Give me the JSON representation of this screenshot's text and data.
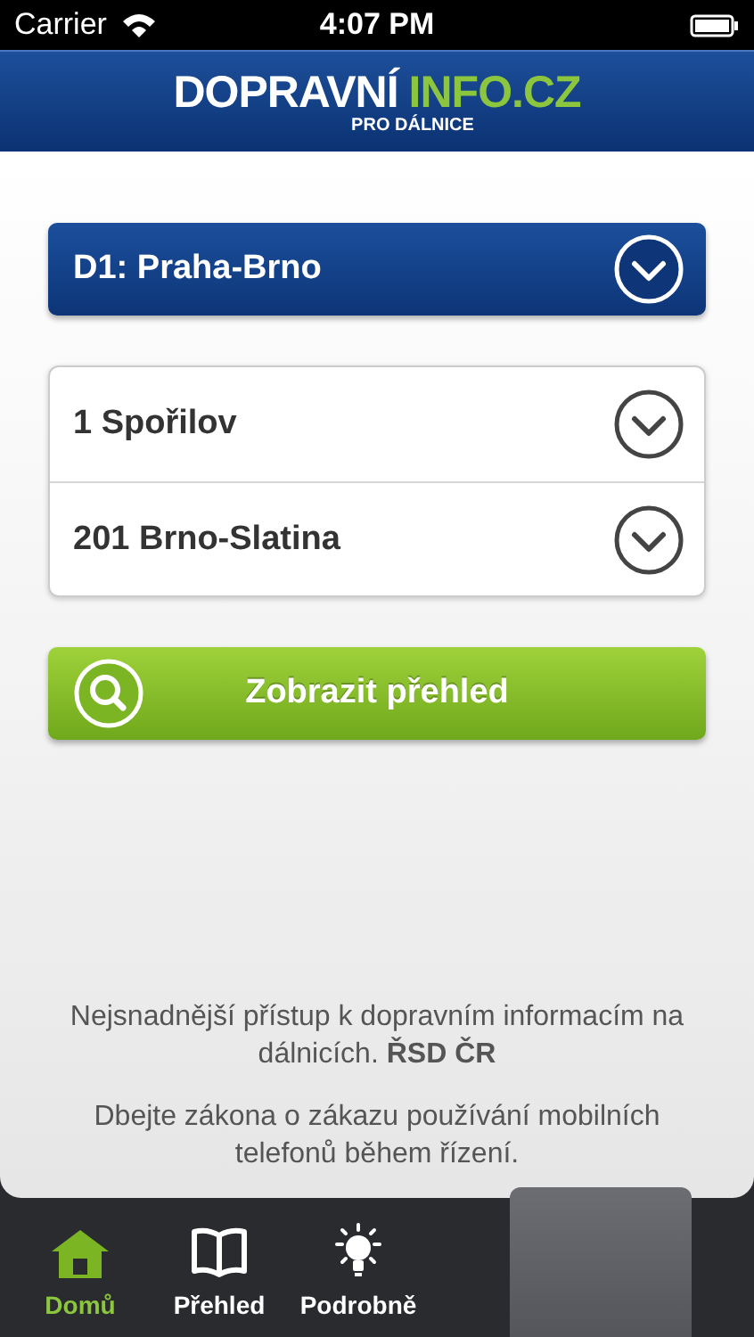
{
  "status_bar": {
    "carrier": "Carrier",
    "time": "4:07 PM"
  },
  "header": {
    "logo_primary": "DOPRAVNÍ",
    "logo_accent": "INFO.CZ",
    "logo_subtitle": "PRO DÁLNICE"
  },
  "highway_select": {
    "value": "D1: Praha-Brno"
  },
  "exit_selects": [
    {
      "value": "1 Spořilov"
    },
    {
      "value": "201 Brno-Slatina"
    }
  ],
  "show_button": {
    "label": "Zobrazit přehled"
  },
  "footer_texts": [
    "Nejsnadnější přístup k dopravním informacím na dálnicích. **ŘSD ČR**",
    "Dbejte zákona o zákazu používání mobilních telefonů během řízení."
  ],
  "tabs": [
    {
      "label": "Domů",
      "kind": "home",
      "selected": true
    },
    {
      "label": "Přehled",
      "kind": "book",
      "selected": false
    },
    {
      "label": "Podrobně",
      "kind": "bulb",
      "selected": false
    }
  ]
}
